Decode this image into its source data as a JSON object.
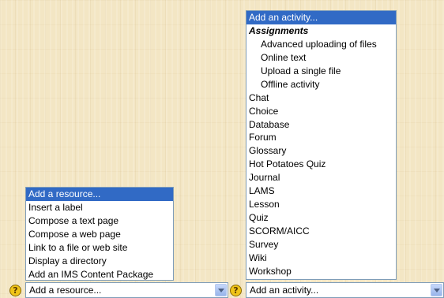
{
  "activity_dropdown": {
    "selected": "Add an activity...",
    "options": [
      {
        "label": "Add an activity...",
        "highlighted": true
      },
      {
        "label": "Assignments",
        "group": true
      },
      {
        "label": "Advanced uploading of files",
        "indent": true
      },
      {
        "label": "Online text",
        "indent": true
      },
      {
        "label": "Upload a single file",
        "indent": true
      },
      {
        "label": "Offline activity",
        "indent": true
      },
      {
        "label": "Chat"
      },
      {
        "label": "Choice"
      },
      {
        "label": "Database"
      },
      {
        "label": "Forum"
      },
      {
        "label": "Glossary"
      },
      {
        "label": "Hot Potatoes Quiz"
      },
      {
        "label": "Journal"
      },
      {
        "label": "LAMS"
      },
      {
        "label": "Lesson"
      },
      {
        "label": "Quiz"
      },
      {
        "label": "SCORM/AICC"
      },
      {
        "label": "Survey"
      },
      {
        "label": "Wiki"
      },
      {
        "label": "Workshop"
      }
    ]
  },
  "resource_dropdown": {
    "selected": "Add a resource...",
    "options": [
      {
        "label": "Add a resource...",
        "highlighted": true
      },
      {
        "label": "Insert a label"
      },
      {
        "label": "Compose a text page"
      },
      {
        "label": "Compose a web page"
      },
      {
        "label": "Link to a file or web site"
      },
      {
        "label": "Display a directory"
      },
      {
        "label": "Add an IMS Content Package"
      }
    ]
  },
  "help_icon": {
    "glyph": "?",
    "color": "#f0c419"
  },
  "icons": [
    "help-icon",
    "chevron-down-icon"
  ],
  "colors": {
    "highlight": "#316ac5",
    "border": "#7f9db9"
  }
}
